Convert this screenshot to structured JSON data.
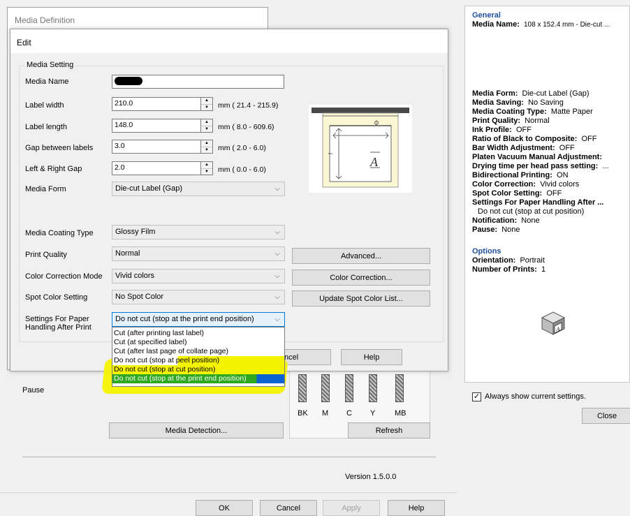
{
  "background_window": {
    "pause_label": "Pause",
    "media_detection_button": "Media Detection...",
    "refresh_button": "Refresh",
    "version_text": "Version 1.5.0.0",
    "ink_labels": [
      "BK",
      "M",
      "C",
      "Y",
      "MB"
    ],
    "ok_button": "OK",
    "cancel_button": "Cancel",
    "apply_button": "Apply",
    "help_button": "Help"
  },
  "media_definition": {
    "title": "Media Definition"
  },
  "edit_dialog": {
    "title": "Edit",
    "group_label": "Media Setting",
    "media_name_label": "Media Name",
    "label_width_label": "Label width",
    "label_width_value": "210.0",
    "label_width_range": "mm ( 21.4 - 215.9)",
    "label_length_label": "Label length",
    "label_length_value": "148.0",
    "label_length_range": "mm ( 8.0 - 609.6)",
    "gap_label": "Gap between labels",
    "gap_value": "3.0",
    "gap_range": "mm ( 2.0 -  6.0)",
    "lr_gap_label": "Left & Right Gap",
    "lr_gap_value": "2.0",
    "lr_gap_range": "mm ( 0.0 -  6.0)",
    "media_form_label": "Media Form",
    "media_form_value": "Die-cut Label (Gap)",
    "coating_label": "Media Coating Type",
    "coating_value": "Glossy Film",
    "quality_label": "Print Quality",
    "quality_value": "Normal",
    "advanced_button": "Advanced...",
    "color_mode_label": "Color Correction Mode",
    "color_mode_value": "Vivid colors",
    "color_correction_button": "Color Correction...",
    "spot_label": "Spot Color Setting",
    "spot_value": "No Spot Color",
    "spot_button": "Update Spot Color List...",
    "paper_handling_label_1": "Settings For Paper",
    "paper_handling_label_2": "Handling After Print",
    "paper_handling_value": "Do not cut (stop at the print end position)",
    "paper_handling_options": [
      "Cut (after printing last label)",
      "Cut (at specified label)",
      "Cut (after last page of collate page)",
      "Do not cut (stop at peel position)",
      "Do not cut (stop at cut position)",
      "Do not cut (stop at the print end position)"
    ],
    "cancel_partial": "ncel",
    "help_button": "Help",
    "preview_letter": "A"
  },
  "settings_panel": {
    "general_heading": "General",
    "lines": [
      {
        "key": "Media Name:",
        "value": "108 x 152.4 mm - Die-cut ..."
      },
      {
        "key": "Media Form:",
        "value": "Die-cut Label (Gap)"
      },
      {
        "key": "Media Saving:",
        "value": "No Saving"
      },
      {
        "key": "Media Coating Type:",
        "value": "Matte Paper"
      },
      {
        "key": "Print Quality:",
        "value": "Normal"
      },
      {
        "key": "Ink Profile:",
        "value": "OFF"
      },
      {
        "key": "Ratio of Black to Composite:",
        "value": "OFF"
      },
      {
        "key": "Bar Width Adjustment:",
        "value": "OFF"
      },
      {
        "key": "Platen Vacuum Manual Adjustment:",
        "value": ""
      },
      {
        "key": "Drying time per head pass setting:",
        "value": "..."
      },
      {
        "key": "Bidirectional Printing:",
        "value": "ON"
      },
      {
        "key": "Color Correction:",
        "value": "Vivid colors"
      },
      {
        "key": "Spot Color Setting:",
        "value": "OFF"
      },
      {
        "key": "Settings For Paper Handling After ...",
        "value": ""
      },
      {
        "key": "",
        "value": "Do not cut (stop at cut position)"
      },
      {
        "key": "Notification:",
        "value": "None"
      },
      {
        "key": "Pause:",
        "value": "None"
      }
    ],
    "options_heading": "Options",
    "option_lines": [
      {
        "key": "Orientation:",
        "value": "Portrait"
      },
      {
        "key": "Number of Prints:",
        "value": "1"
      }
    ],
    "always_show_label": "Always show current settings.",
    "always_show_checked": true,
    "close_button": "Close"
  },
  "colors": {
    "heading_blue": "#1f4e9c",
    "highlight_yellow": "#f3f300",
    "highlight_green": "#2ea81e",
    "selection_blue": "#0a63d1"
  }
}
